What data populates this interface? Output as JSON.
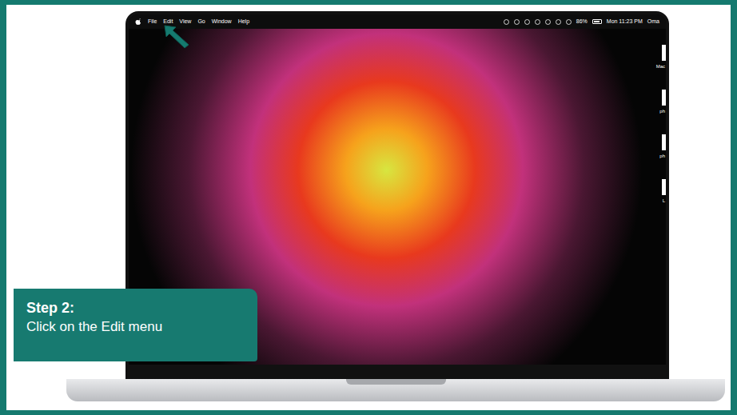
{
  "menu_bar": {
    "menus": [
      "File",
      "Edit",
      "View",
      "Go",
      "Window",
      "Help"
    ],
    "battery_percent": "86%",
    "battery_level": 0.86,
    "clock": "Mon 11:23 PM",
    "user": "Oma"
  },
  "desktop_icons": [
    "Mac",
    "ph",
    "ph",
    "L"
  ],
  "caption": {
    "step": "Step 2:",
    "instruction": "Click on the Edit menu"
  }
}
